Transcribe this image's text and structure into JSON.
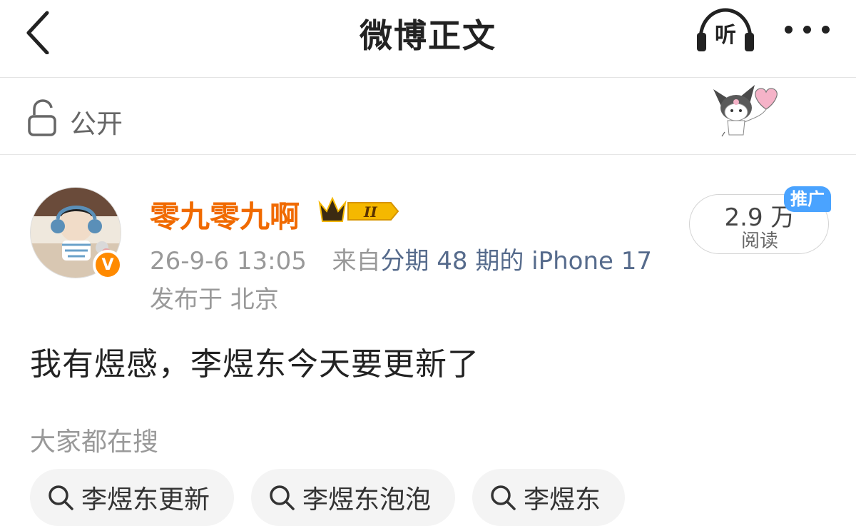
{
  "nav": {
    "title": "微博正文",
    "listen_label": "听"
  },
  "visibility": {
    "label": "公开"
  },
  "author": {
    "name": "零九零九啊",
    "verified_badge": "V",
    "level_badge": "II",
    "timestamp": "26-9-6 13:05",
    "source_prefix": "来自",
    "source_device": "分期 48 期的 iPhone 17",
    "location": "发布于 北京"
  },
  "reads": {
    "count": "2.9 万",
    "label": "阅读",
    "promo_tag": "推广"
  },
  "post": {
    "text": "我有煜感，李煜东今天要更新了"
  },
  "trending": {
    "title": "大家都在搜",
    "items": [
      {
        "label": "李煜东更新"
      },
      {
        "label": "李煜东泡泡"
      },
      {
        "label": "李煜东"
      }
    ]
  },
  "colors": {
    "username": "#f06a00",
    "link": "#566b8c",
    "promo": "#4aa3ff",
    "verified": "#ff8a00"
  }
}
